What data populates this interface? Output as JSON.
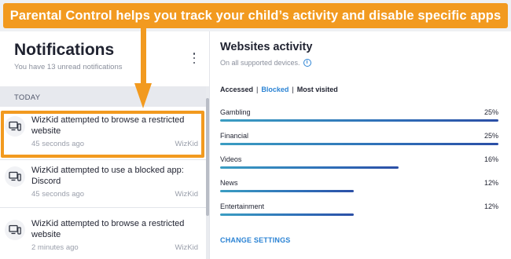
{
  "banner": {
    "text": "Parental Control helps you track your child’s activity and disable specific apps",
    "color": "#f29a1f"
  },
  "notifications": {
    "title": "Notifications",
    "subtitle": "You have 13 unread notifications",
    "menu_icon": "kebab-menu-icon",
    "section_label": "TODAY",
    "items": [
      {
        "text": "WizKid attempted to browse a restricted website",
        "time": "45 seconds ago",
        "who": "WizKid",
        "icon": "device-icon"
      },
      {
        "text": "WizKid attempted to use a blocked app: Discord",
        "time": "45 seconds ago",
        "who": "WizKid",
        "icon": "device-icon"
      },
      {
        "text": "WizKid attempted to browse a restricted website",
        "time": "2 minutes ago",
        "who": "WizKid",
        "icon": "device-icon"
      }
    ]
  },
  "websites": {
    "title": "Websites activity",
    "subtitle": "On all supported devices.",
    "info_icon": "i",
    "filters": {
      "accessed": "Accessed",
      "separator": "|",
      "blocked": "Blocked",
      "most_visited": "Most visited",
      "active": "Blocked"
    },
    "categories": [
      {
        "name": "Gambling",
        "percent_label": "25%",
        "value": 25
      },
      {
        "name": "Financial",
        "percent_label": "25%",
        "value": 25
      },
      {
        "name": "Videos",
        "percent_label": "16%",
        "value": 16
      },
      {
        "name": "News",
        "percent_label": "12%",
        "value": 12
      },
      {
        "name": "Entertainment",
        "percent_label": "12%",
        "value": 12
      }
    ],
    "change_settings": "CHANGE SETTINGS",
    "accent_color": "#2b83d4"
  }
}
